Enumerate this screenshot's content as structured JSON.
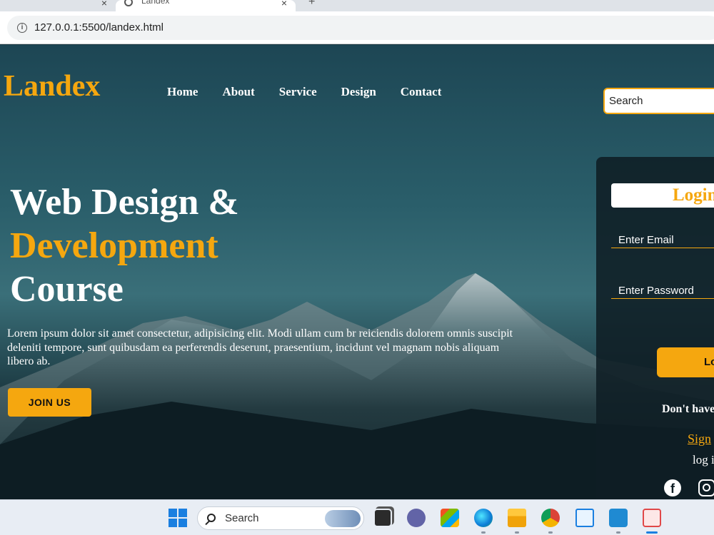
{
  "browser": {
    "tabs": [
      {
        "title": ""
      },
      {
        "title": "Landex"
      }
    ],
    "url": "127.0.0.1:5500/landex.html"
  },
  "site": {
    "logo": "Landex",
    "nav": [
      "Home",
      "About",
      "Service",
      "Design",
      "Contact"
    ],
    "search_value": "Search",
    "headline": {
      "line1": "Web Design &",
      "line2": "Development",
      "line3": "Course"
    },
    "description": "Lorem ipsum dolor sit amet consectetur, adipisicing elit. Modi ullam cum br reiciendis dolorem omnis suscipit deleniti tempore, sunt quibusdam ea perferendis deserunt, praesentium, incidunt vel magnam nobis aliquam libero ab.",
    "join_label": "JOIN US",
    "colors": {
      "accent": "#f5a70f",
      "text": "#ffffff"
    }
  },
  "login": {
    "title": "Login",
    "email_placeholder": "Enter Email",
    "password_placeholder": "Enter Password",
    "button_label": "Lo",
    "no_account_text": "Don't have",
    "signup_text": "Sign",
    "log_via_text": "log i",
    "social_icons": [
      "facebook-icon",
      "instagram-icon"
    ]
  },
  "taskbar": {
    "search_label": "Search",
    "apps": [
      "start",
      "search",
      "task-view",
      "teams",
      "store",
      "edge",
      "file-explorer",
      "chrome",
      "notepad",
      "vscode",
      "snipping-tool"
    ]
  }
}
